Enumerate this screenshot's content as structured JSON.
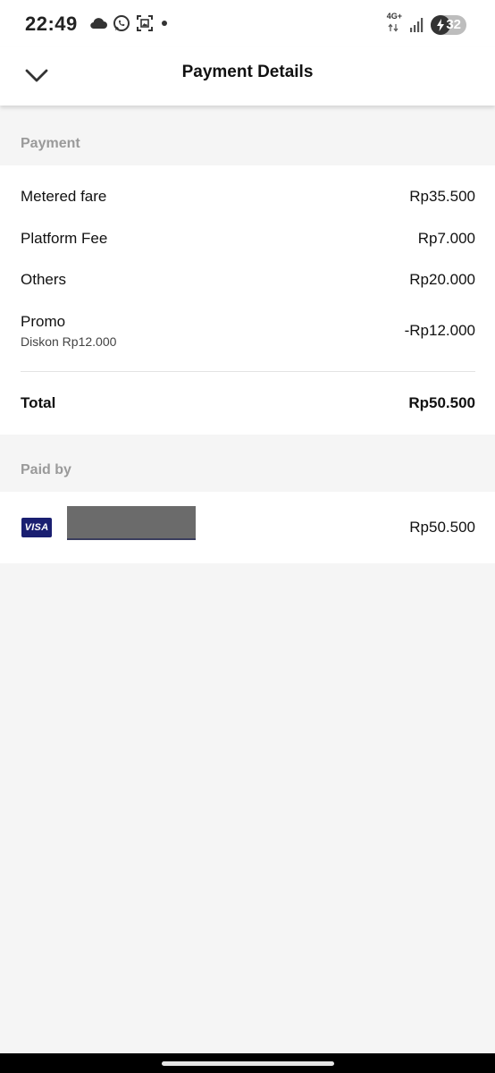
{
  "status_bar": {
    "time": "22:49",
    "network": "4G+",
    "battery": "32",
    "icons": [
      "cloud-icon",
      "whatsapp-icon",
      "screenshot-icon",
      "dot-icon",
      "signal-icon",
      "battery-charging-icon"
    ]
  },
  "header": {
    "title": "Payment Details",
    "back_icon": "chevron-down-icon"
  },
  "payment": {
    "section_label": "Payment",
    "items": [
      {
        "label": "Metered fare",
        "amount": "Rp35.500"
      },
      {
        "label": "Platform Fee",
        "amount": "Rp7.000"
      },
      {
        "label": "Others",
        "amount": "Rp20.000"
      },
      {
        "label": "Promo",
        "sublabel": "Diskon Rp12.000",
        "amount": "-Rp12.000"
      }
    ],
    "total_label": "Total",
    "total_amount": "Rp50.500"
  },
  "paid_by": {
    "section_label": "Paid by",
    "card_brand": "VISA",
    "amount": "Rp50.500"
  },
  "colors": {
    "background": "#f5f5f5",
    "card": "#ffffff",
    "section_label": "#9a9a9a",
    "visa": "#1a1f71"
  }
}
